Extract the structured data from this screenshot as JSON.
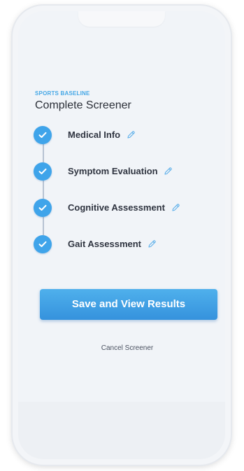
{
  "header": {
    "eyebrow": "SPORTS BASELINE",
    "title": "Complete Screener"
  },
  "steps": [
    {
      "label": "Medical Info",
      "status": "complete",
      "edit_icon": "pencil-icon"
    },
    {
      "label": "Symptom Evaluation",
      "status": "complete",
      "edit_icon": "pencil-icon"
    },
    {
      "label": "Cognitive Assessment",
      "status": "complete",
      "edit_icon": "pencil-icon"
    },
    {
      "label": "Gait Assessment",
      "status": "complete",
      "edit_icon": "pencil-icon"
    }
  ],
  "actions": {
    "save_label": "Save and View Results",
    "cancel_label": "Cancel Screener"
  },
  "colors": {
    "accent": "#3fa4ea",
    "title_text": "#2b2f38",
    "connector": "#b7c2d2"
  }
}
